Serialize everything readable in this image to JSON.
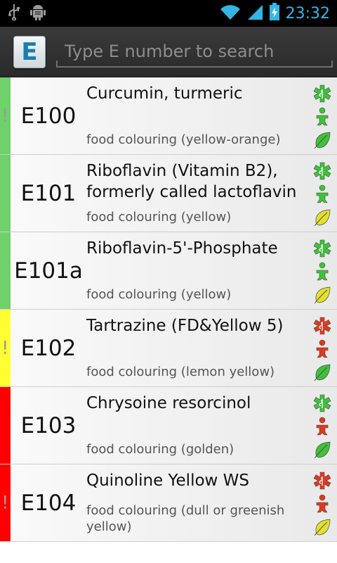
{
  "status_bar": {
    "time": "23:32",
    "icons": [
      "usb-icon",
      "android-debug-icon",
      "wifi-icon",
      "signal-icon",
      "battery-charging-icon"
    ]
  },
  "action_bar": {
    "app_icon_letter": "E",
    "search_placeholder": "Type E number to search",
    "search_value": ""
  },
  "colors": {
    "green": "#6fd16a",
    "yellow": "#ffff33",
    "red": "#ff0000",
    "icon_green": "#3fc23a",
    "icon_red": "#dd3a1f",
    "icon_yellow": "#e2e02c",
    "accent": "#33b5e5"
  },
  "items": [
    {
      "code": "E100",
      "name": "Curcumin, turmeric",
      "description": "food colouring (yellow-orange)",
      "rating": "green",
      "warning": "!",
      "icons": {
        "medical": "green",
        "child": "green",
        "leaf": "green"
      }
    },
    {
      "code": "E101",
      "name": "Riboflavin (Vitamin B2), formerly called lactoflavin",
      "description": "food colouring (yellow)",
      "rating": "green",
      "warning": "",
      "icons": {
        "medical": "green",
        "child": "green",
        "leaf": "yellow"
      }
    },
    {
      "code": "E101a",
      "name": "Riboflavin-5'-Phosphate",
      "description": "food colouring (yellow)",
      "rating": "green",
      "warning": "",
      "icons": {
        "medical": "green",
        "child": "green",
        "leaf": "yellow"
      }
    },
    {
      "code": "E102",
      "name": "Tartrazine (FD&Yellow 5)",
      "description": "food colouring (lemon yellow)",
      "rating": "yellow",
      "warning": "!",
      "icons": {
        "medical": "red",
        "child": "red",
        "leaf": "green"
      }
    },
    {
      "code": "E103",
      "name": "Chrysoine resorcinol",
      "description": "food colouring (golden)",
      "rating": "red",
      "warning": "",
      "icons": {
        "medical": "green",
        "child": "red",
        "leaf": "green"
      }
    },
    {
      "code": "E104",
      "name": "Quinoline Yellow WS",
      "description": "food colouring (dull or greenish yellow)",
      "rating": "red",
      "warning": "!",
      "icons": {
        "medical": "red",
        "child": "red",
        "leaf": "yellow"
      }
    }
  ]
}
